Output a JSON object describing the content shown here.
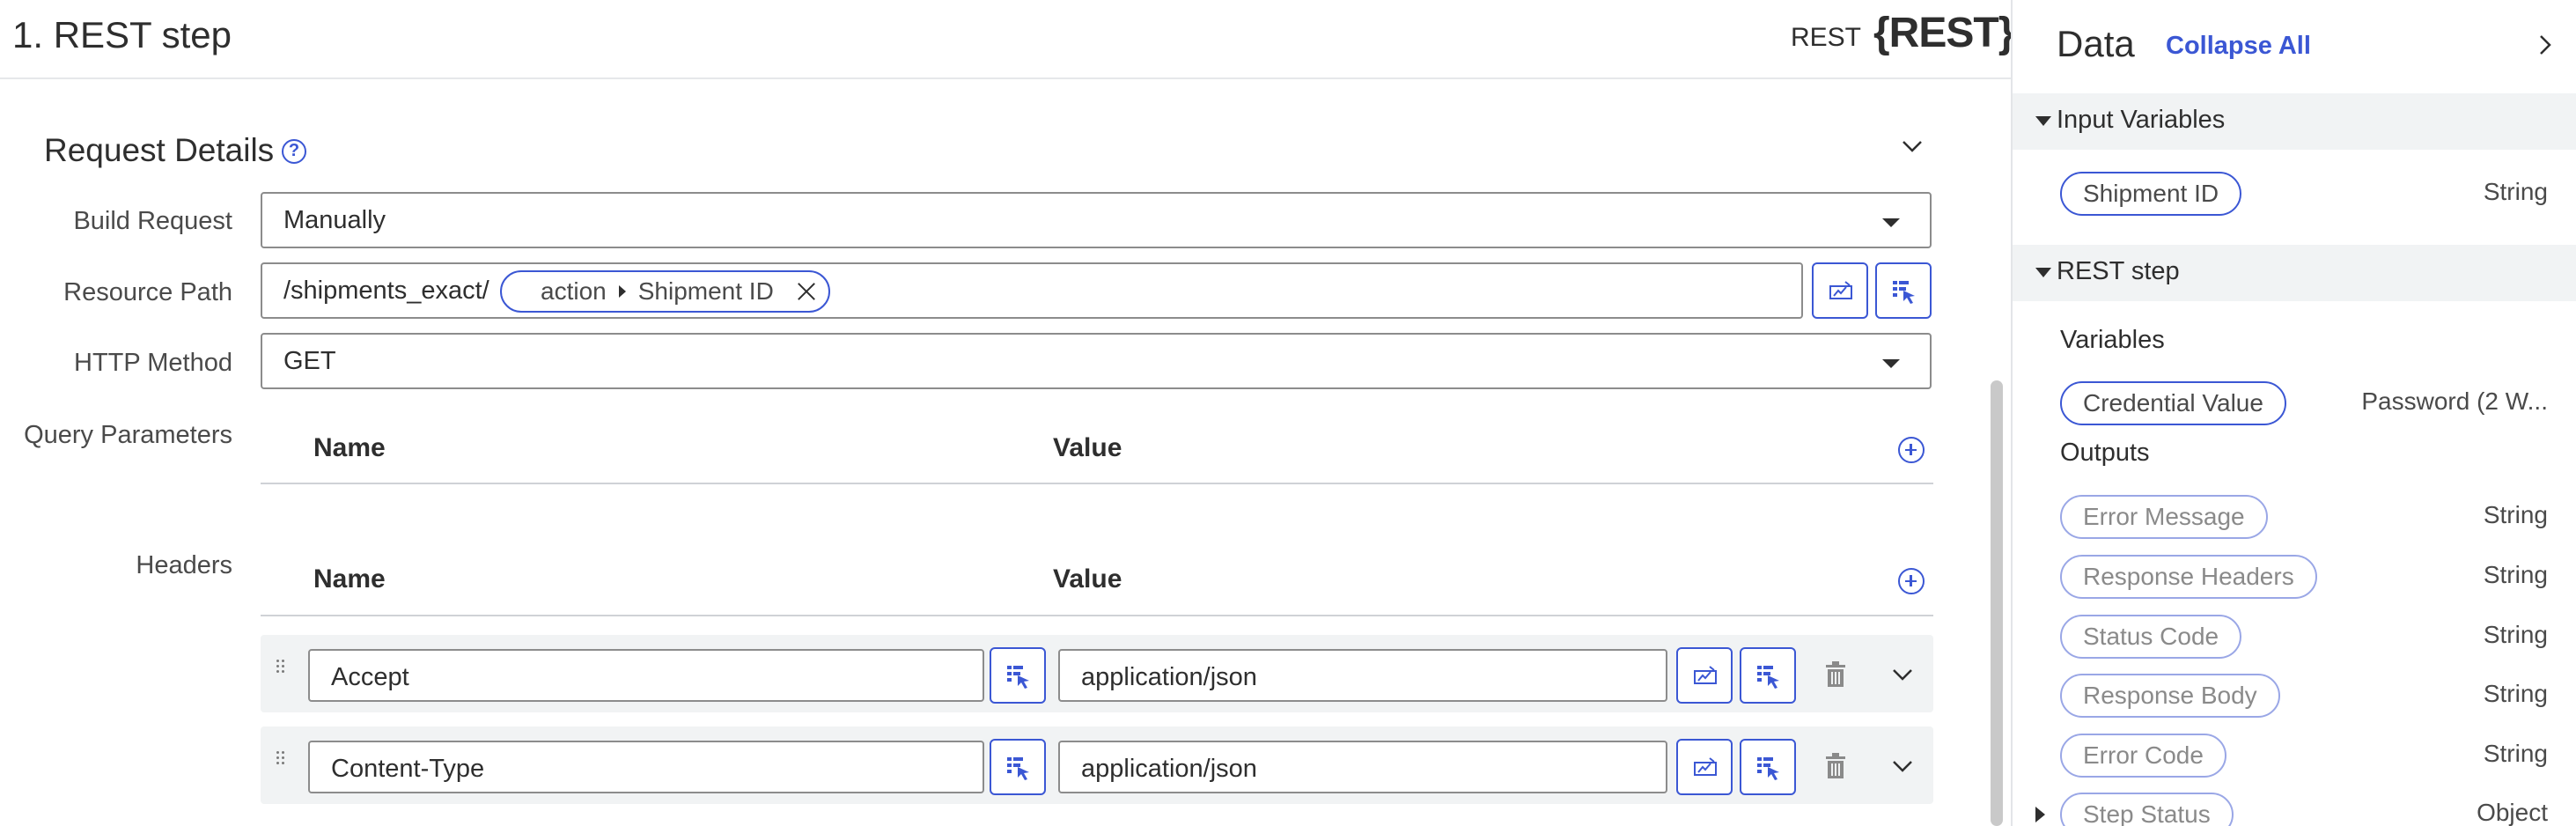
{
  "step": {
    "title": "1.  REST step",
    "type_label": "REST",
    "logo": "{REST}"
  },
  "request": {
    "section_title": "Request Details",
    "help_glyph": "?",
    "build_request": {
      "label": "Build Request",
      "value": "Manually"
    },
    "resource_path": {
      "label": "Resource Path",
      "prefix": "/shipments_exact/",
      "pill_source": "action",
      "pill_value": "Shipment ID"
    },
    "http_method": {
      "label": "HTTP Method",
      "value": "GET"
    },
    "query_parameters": {
      "label": "Query Parameters",
      "name_header": "Name",
      "value_header": "Value"
    },
    "headers": {
      "label": "Headers",
      "name_header": "Name",
      "value_header": "Value",
      "rows": [
        {
          "name": "Accept",
          "value": "application/json"
        },
        {
          "name": "Content-Type",
          "value": "application/json"
        }
      ]
    }
  },
  "panel": {
    "title": "Data",
    "collapse_all": "Collapse All",
    "input_variables": {
      "label": "Input Variables",
      "items": [
        {
          "name": "Shipment ID",
          "type": "String"
        }
      ]
    },
    "rest_step": {
      "label": "REST step",
      "variables_label": "Variables",
      "variables": [
        {
          "name": "Credential Value",
          "type": "Password (2 W..."
        }
      ],
      "outputs_label": "Outputs",
      "outputs": [
        {
          "name": "Error Message",
          "type": "String"
        },
        {
          "name": "Response Headers",
          "type": "String"
        },
        {
          "name": "Status Code",
          "type": "String"
        },
        {
          "name": "Response Body",
          "type": "String"
        },
        {
          "name": "Error Code",
          "type": "String"
        },
        {
          "name": "Step Status",
          "type": "Object"
        }
      ]
    }
  },
  "colors": {
    "accent": "#3b57d4",
    "border": "#8c8c8c",
    "row_bg": "#f1f3f4"
  }
}
